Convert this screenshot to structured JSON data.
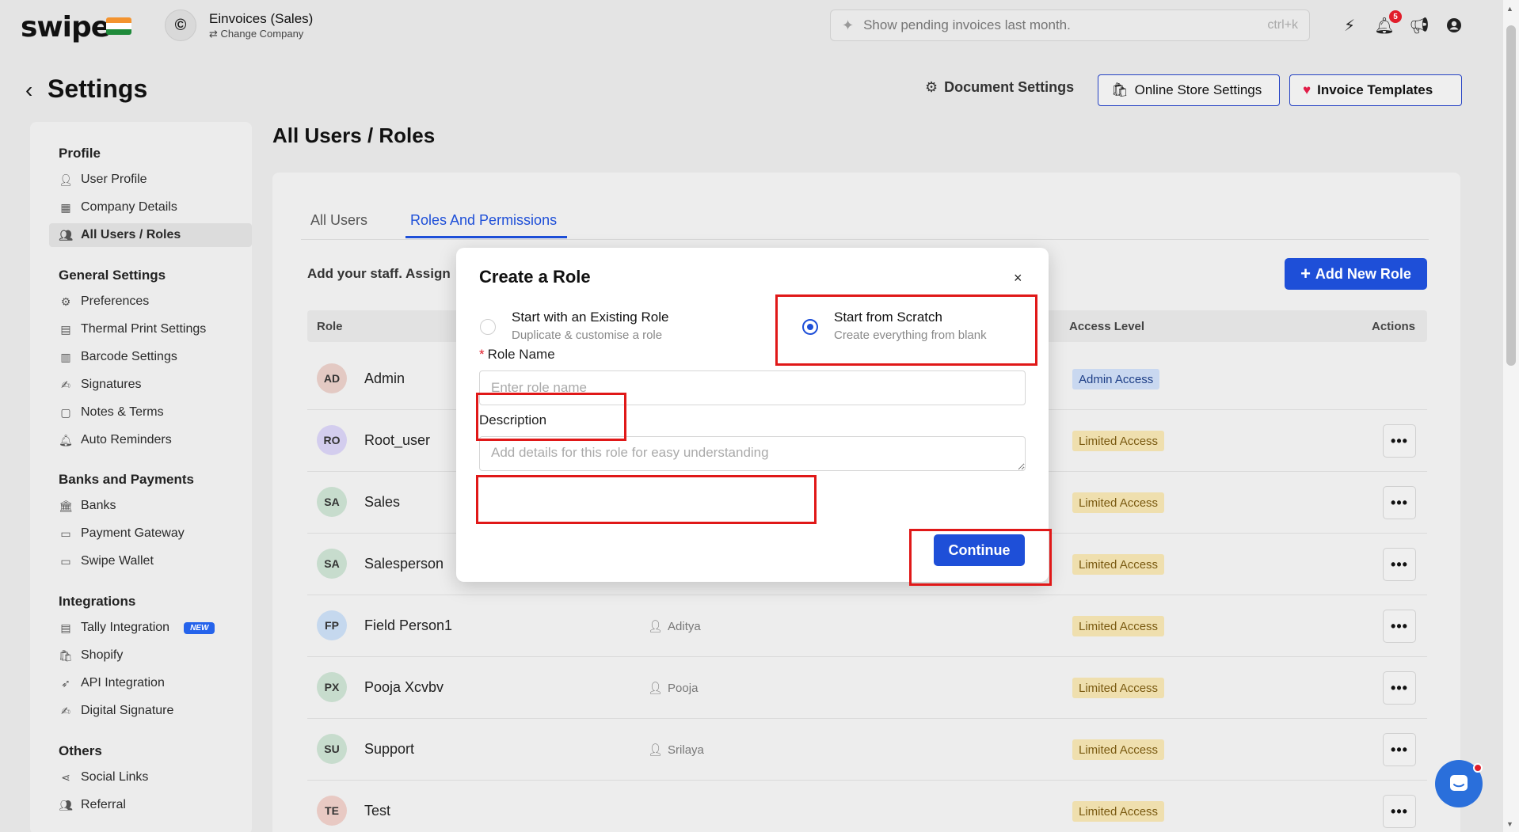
{
  "topbar": {
    "logo": "swipe",
    "company_name": "Einvoices (Sales)",
    "change_company": "Change Company",
    "search_placeholder": "Show pending invoices last month.",
    "search_shortcut": "ctrl+k",
    "notification_count": "5"
  },
  "header": {
    "title": "Settings",
    "document_settings": "Document Settings",
    "online_store_settings": "Online Store Settings",
    "invoice_templates": "Invoice Templates"
  },
  "sidebar": {
    "sections": [
      {
        "heading": "Profile",
        "items": [
          "User Profile",
          "Company Details",
          "All Users / Roles"
        ]
      },
      {
        "heading": "General Settings",
        "items": [
          "Preferences",
          "Thermal Print Settings",
          "Barcode Settings",
          "Signatures",
          "Notes & Terms",
          "Auto Reminders"
        ]
      },
      {
        "heading": "Banks and Payments",
        "items": [
          "Banks",
          "Payment Gateway",
          "Swipe Wallet"
        ]
      },
      {
        "heading": "Integrations",
        "items": [
          "Tally Integration",
          "Shopify",
          "API Integration",
          "Digital Signature"
        ]
      },
      {
        "heading": "Others",
        "items": [
          "Social Links",
          "Referral"
        ]
      }
    ],
    "new_badge": "NEW"
  },
  "main": {
    "page_title": "All Users / Roles",
    "tabs": [
      "All Users",
      "Roles And Permissions"
    ],
    "intro_text": "Add your staff. Assign",
    "add_role_button": "Add New Role",
    "columns": {
      "role": "Role",
      "access_level": "Access Level",
      "actions": "Actions"
    },
    "rows": [
      {
        "initials": "AD",
        "name": "Admin",
        "user": "",
        "access": "Admin Access",
        "avatar_color": "#e3c9c3"
      },
      {
        "initials": "RO",
        "name": "Root_user",
        "user": "",
        "access": "Limited Access",
        "avatar_color": "#d3cdee"
      },
      {
        "initials": "SA",
        "name": "Sales",
        "user": "",
        "access": "Limited Access",
        "avatar_color": "#c7dccd"
      },
      {
        "initials": "SA",
        "name": "Salesperson",
        "user": "",
        "access": "Limited Access",
        "avatar_color": "#c7dccd"
      },
      {
        "initials": "FP",
        "name": "Field Person1",
        "user": "Aditya",
        "access": "Limited Access",
        "avatar_color": "#c5d8ee"
      },
      {
        "initials": "PX",
        "name": "Pooja Xcvbv",
        "user": "Pooja",
        "access": "Limited Access",
        "avatar_color": "#c7dccd"
      },
      {
        "initials": "SU",
        "name": "Support",
        "user": "Srilaya",
        "access": "Limited Access",
        "avatar_color": "#c7dccd"
      },
      {
        "initials": "TE",
        "name": "Test",
        "user": "",
        "access": "Limited Access",
        "avatar_color": "#e8c9c3"
      }
    ]
  },
  "modal": {
    "title": "Create a Role",
    "close": "×",
    "option_existing_title": "Start with an Existing Role",
    "option_existing_sub": "Duplicate & customise a role",
    "option_scratch_title": "Start from Scratch",
    "option_scratch_sub": "Create everything from blank",
    "required_mark": "*",
    "role_name_label": "Role Name",
    "role_name_placeholder": "Enter role name",
    "description_label": "Description",
    "description_placeholder": "Add details for this role for easy understanding",
    "continue": "Continue"
  },
  "colors": {
    "accent": "#1e4fd8",
    "annotation": "#e01818"
  }
}
